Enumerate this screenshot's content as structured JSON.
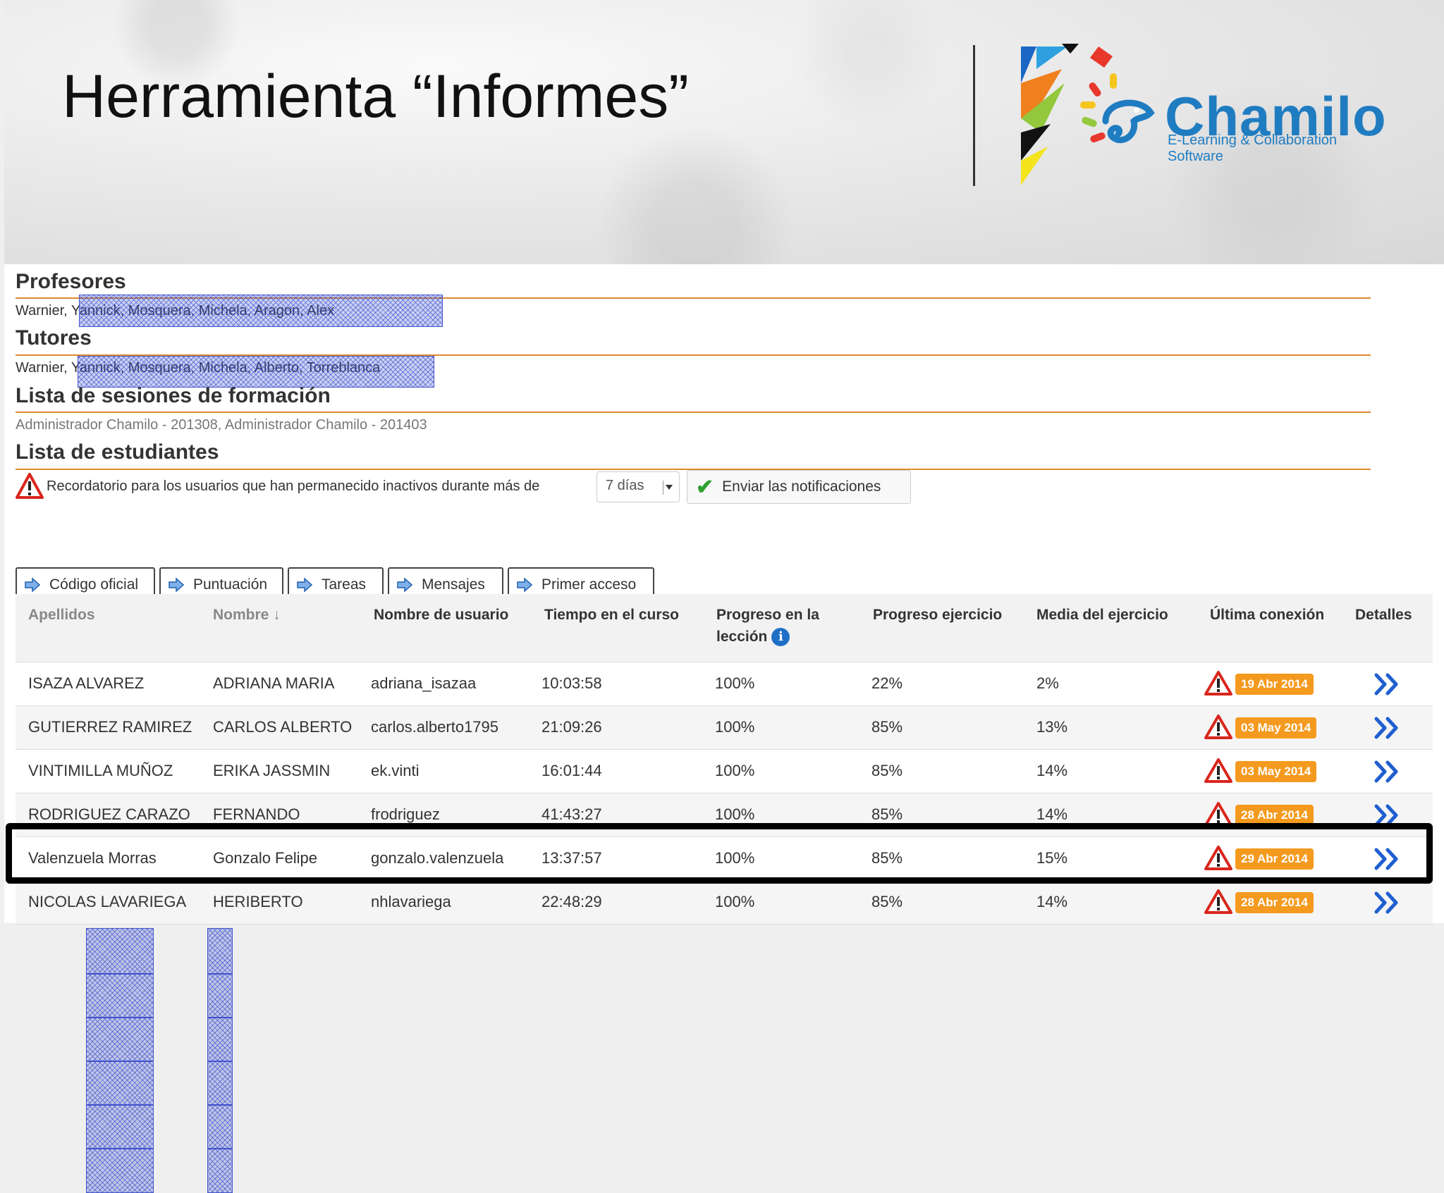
{
  "slide": {
    "title": "Herramienta “Informes”",
    "logo_name": "Chamilo",
    "logo_subtitle": "E-Learning & Collaboration Software"
  },
  "sections": {
    "profesores": {
      "title": "Profesores",
      "names": "Warnier, Yannick, Mosquera, Michela, Aragon, Alex"
    },
    "tutores": {
      "title": "Tutores",
      "names": "Warnier, Yannick, Mosquera, Michela, Alberto, Torreblanca"
    },
    "sesiones": {
      "title": "Lista de sesiones de formación",
      "items": "Administrador Chamilo - 201308, Administrador Chamilo - 201403"
    },
    "estudiantes": {
      "title": "Lista de estudiantes"
    }
  },
  "reminder": {
    "text": "Recordatorio para los usuarios que han permanecido inactivos durante más de",
    "selected_days": "7 días",
    "send_label": "Enviar las notificaciones"
  },
  "tabs": [
    "Código oficial",
    "Puntuación",
    "Tareas",
    "Mensajes",
    "Primer acceso"
  ],
  "table": {
    "headers": {
      "apellidos": "Apellidos",
      "nombre": "Nombre ↓",
      "usuario": "Nombre de usuario",
      "tiempo": "Tiempo en el curso",
      "progreso_leccion_1": "Progreso en la",
      "progreso_leccion_2": "lección",
      "progreso_ejercicio": "Progreso ejercicio",
      "media_ejercicio": "Media del ejercicio",
      "ultima_conexion": "Última conexión",
      "detalles": "Detalles"
    },
    "rows": [
      {
        "apellidos": "ISAZA ALVAREZ",
        "nombre": "ADRIANA MARIA",
        "usuario": "adriana_isazaa",
        "tiempo": "10:03:58",
        "progreso_leccion": "100%",
        "progreso_ejercicio": "22%",
        "media": "2%",
        "ultima_conexion": "19 Abr 2014"
      },
      {
        "apellidos": "GUTIERREZ RAMIREZ",
        "nombre": "CARLOS ALBERTO",
        "usuario": "carlos.alberto1795",
        "tiempo": "21:09:26",
        "progreso_leccion": "100%",
        "progreso_ejercicio": "85%",
        "media": "13%",
        "ultima_conexion": "03 May 2014"
      },
      {
        "apellidos": "VINTIMILLA MUÑOZ",
        "nombre": "ERIKA JASSMIN",
        "usuario": "ek.vinti",
        "tiempo": "16:01:44",
        "progreso_leccion": "100%",
        "progreso_ejercicio": "85%",
        "media": "14%",
        "ultima_conexion": "03 May 2014"
      },
      {
        "apellidos": "RODRIGUEZ CARAZO",
        "nombre": "FERNANDO",
        "usuario": "frodriguez",
        "tiempo": "41:43:27",
        "progreso_leccion": "100%",
        "progreso_ejercicio": "85%",
        "media": "14%",
        "ultima_conexion": "28 Abr 2014"
      },
      {
        "apellidos": "Valenzuela Morras",
        "nombre": "Gonzalo Felipe",
        "usuario": "gonzalo.valenzuela",
        "tiempo": "13:37:57",
        "progreso_leccion": "100%",
        "progreso_ejercicio": "85%",
        "media": "15%",
        "ultima_conexion": "29 Abr 2014"
      },
      {
        "apellidos": "NICOLAS LAVARIEGA",
        "nombre": "HERIBERTO",
        "usuario": "nhlavariega",
        "tiempo": "22:48:29",
        "progreso_leccion": "100%",
        "progreso_ejercicio": "85%",
        "media": "14%",
        "ultima_conexion": "28 Abr 2014"
      }
    ]
  },
  "colors": {
    "accent_orange": "#e08a2e",
    "badge_orange": "#f49a1f",
    "link_blue": "#1f6fc7",
    "warning_red": "#d9261c",
    "chamilo_blue": "#1f7cc1"
  },
  "icons": {
    "reminder": "warning-icon",
    "send": "check-icon",
    "tab": "arrow-right-icon",
    "info": "info-icon",
    "status": "warning-icon",
    "details": "double-chevron-right-icon"
  }
}
